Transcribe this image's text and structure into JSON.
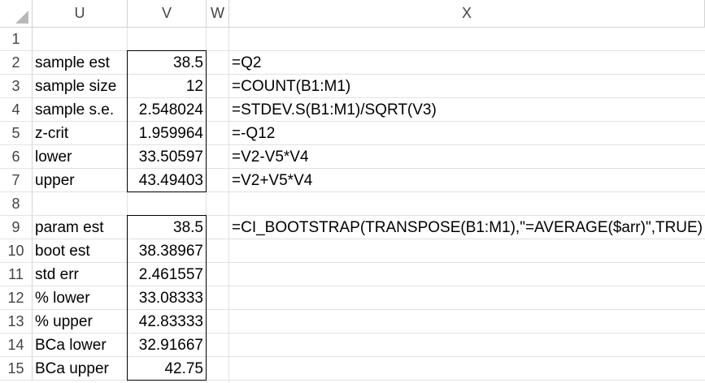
{
  "columns": [
    {
      "id": "U",
      "label": "U"
    },
    {
      "id": "V",
      "label": "V"
    },
    {
      "id": "W",
      "label": "W"
    },
    {
      "id": "X",
      "label": "X"
    }
  ],
  "rows": [
    {
      "num": "1",
      "u": "",
      "v": "",
      "x": ""
    },
    {
      "num": "2",
      "u": "sample est",
      "v": "38.5",
      "x": "=Q2"
    },
    {
      "num": "3",
      "u": "sample size",
      "v": "12",
      "x": "=COUNT(B1:M1)"
    },
    {
      "num": "4",
      "u": "sample s.e.",
      "v": "2.548024",
      "x": "=STDEV.S(B1:M1)/SQRT(V3)"
    },
    {
      "num": "5",
      "u": "z-crit",
      "v": "1.959964",
      "x": "=-Q12"
    },
    {
      "num": "6",
      "u": "lower",
      "v": "33.50597",
      "x": "=V2-V5*V4"
    },
    {
      "num": "7",
      "u": "upper",
      "v": "43.49403",
      "x": "=V2+V5*V4"
    },
    {
      "num": "8",
      "u": "",
      "v": "",
      "x": ""
    },
    {
      "num": "9",
      "u": "param est",
      "v": "38.5",
      "x": "=CI_BOOTSTRAP(TRANSPOSE(B1:M1),\"=AVERAGE($arr)\",TRUE)"
    },
    {
      "num": "10",
      "u": "boot est",
      "v": "38.38967",
      "x": ""
    },
    {
      "num": "11",
      "u": "std err",
      "v": "2.461557",
      "x": ""
    },
    {
      "num": "12",
      "u": "% lower",
      "v": "33.08333",
      "x": ""
    },
    {
      "num": "13",
      "u": "% upper",
      "v": "42.83333",
      "x": ""
    },
    {
      "num": "14",
      "u": "BCa lower",
      "v": "32.91667",
      "x": ""
    },
    {
      "num": "15",
      "u": "BCa upper",
      "v": "42.75",
      "x": ""
    }
  ]
}
